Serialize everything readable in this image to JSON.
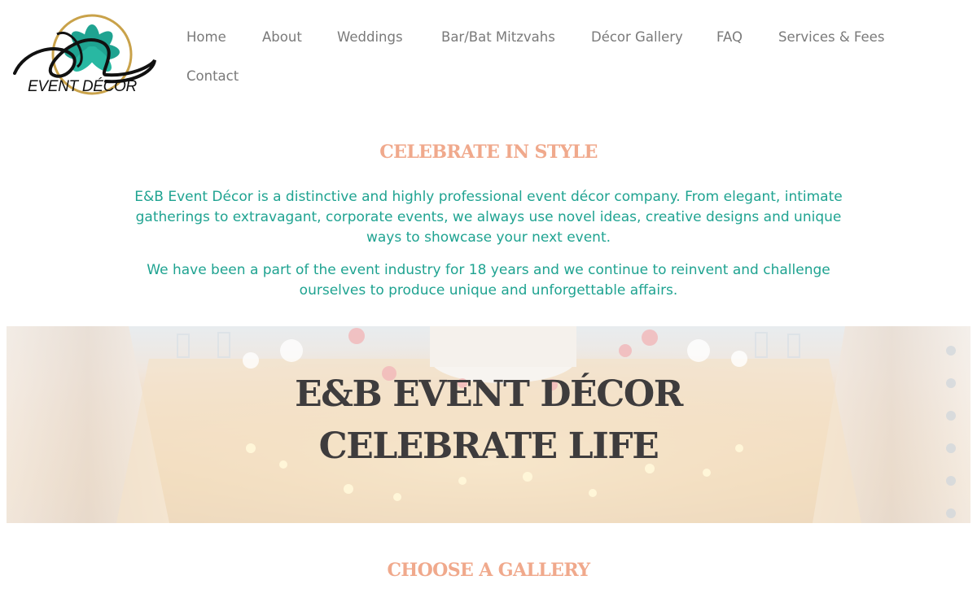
{
  "brand": {
    "logo_letters": "E&B",
    "logo_text": "EVENT DÉCOR",
    "colors": {
      "teal": "#1fa391",
      "gold": "#c9a24a",
      "peach": "#f0a98c"
    }
  },
  "nav": {
    "items": [
      {
        "label": "Home"
      },
      {
        "label": "About"
      },
      {
        "label": "Weddings"
      },
      {
        "label": "Bar/Bat Mitzvahs"
      },
      {
        "label": "Décor Gallery"
      },
      {
        "label": "FAQ"
      },
      {
        "label": "Services & Fees"
      },
      {
        "label": "Contact"
      }
    ]
  },
  "intro": {
    "heading": "CELEBRATE IN STYLE",
    "paragraph1": "E&B Event Décor is a distinctive and highly professional event décor company. From elegant, intimate gatherings to extravagant, corporate events, we always use novel ideas, creative designs and unique ways to showcase your next event.",
    "paragraph2": "We have been a part of the event industry for 18 years and we continue to reinvent and challenge ourselves to produce unique and unforgettable affairs."
  },
  "hero": {
    "line1": "E&B EVENT DÉCOR",
    "line2": "CELEBRATE LIFE"
  },
  "gallery": {
    "heading": "CHOOSE A GALLERY"
  }
}
